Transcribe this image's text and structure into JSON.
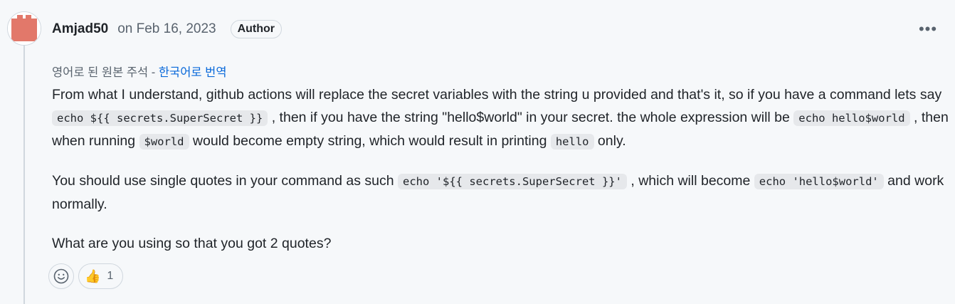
{
  "comment": {
    "author": "Amjad50",
    "timestamp": "on Feb 16, 2023",
    "badge": "Author",
    "more_icon": "kebab-horizontal-icon",
    "translation": {
      "prefix": "영어로 된 원본 주석 - ",
      "link": "한국어로 번역"
    },
    "paragraphs": {
      "p1": {
        "t1": "From what I understand, github actions will replace the secret variables with the string u provided and that's it, so if you have a command lets say ",
        "c1": "echo ${{ secrets.SuperSecret }}",
        "t2": " , then if you have the string \"hello$world\" in your secret. the whole expression will be ",
        "c2": "echo hello$world",
        "t3": " , then when running ",
        "c3": "$world",
        "t4": " would become empty string, which would result in printing ",
        "c4": "hello",
        "t5": " only."
      },
      "p2": {
        "t1": "You should use single quotes in your command as such ",
        "c1": "echo '${{ secrets.SuperSecret }}'",
        "t2": " , which will become ",
        "c2": "echo 'hello$world'",
        "t3": " and work normally."
      },
      "p3": {
        "t1": "What are you using so that you got 2 quotes?"
      }
    },
    "reactions": {
      "add_icon": "smiley-icon",
      "items": [
        {
          "emoji": "👍",
          "icon": "thumbs-up-icon",
          "count": "1"
        }
      ]
    },
    "colors": {
      "link": "#0969da",
      "muted": "#59636e",
      "avatar": "#e2786a"
    }
  }
}
